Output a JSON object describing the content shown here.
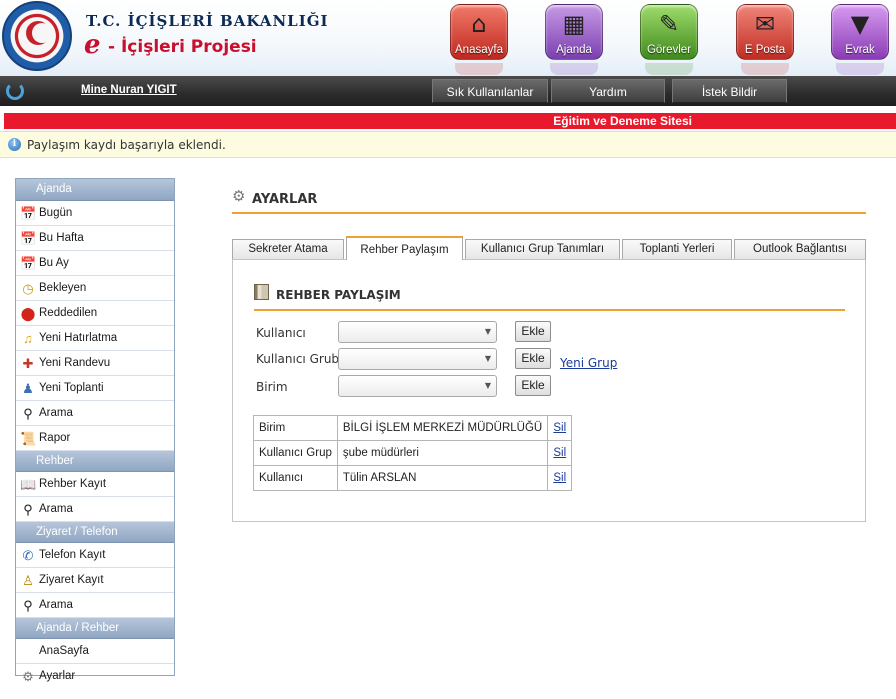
{
  "header": {
    "ministry": "T.C. İÇİŞLERİ BAKANLIĞI",
    "project_prefix": "e",
    "project": "- İçişleri Projesi",
    "seal_text": "TÜRKİYE CUMHURİYETİ İÇİŞLERİ BAKANLIĞI",
    "top_icons": [
      {
        "label": "Anasayfa",
        "icon": "home-icon"
      },
      {
        "label": "Ajanda",
        "icon": "calendar-icon"
      },
      {
        "label": "Görevler",
        "icon": "tasks-icon"
      },
      {
        "label": "E Posta",
        "icon": "mail-icon"
      },
      {
        "label": "Evrak",
        "icon": "document-icon"
      }
    ]
  },
  "navbar": {
    "user": "Mine Nuran YIGIT",
    "buttons": [
      "Sık Kullanılanlar",
      "Yardım",
      "İstek Bildir"
    ]
  },
  "banner": "Eğitim ve Deneme Sitesi",
  "message": "Paylaşım kaydı başarıyla eklendi.",
  "sidebar": {
    "sections": [
      {
        "title": "Ajanda",
        "items": [
          "Bugün",
          "Bu Hafta",
          "Bu Ay",
          "Bekleyen",
          "Reddedilen",
          "Yeni Hatırlatma",
          "Yeni Randevu",
          "Yeni Toplanti",
          "Arama",
          "Rapor"
        ]
      },
      {
        "title": "Rehber",
        "items": [
          "Rehber Kayıt",
          "Arama"
        ]
      },
      {
        "title": "Ziyaret / Telefon",
        "items": [
          "Telefon Kayıt",
          "Ziyaret Kayıt",
          "Arama"
        ]
      },
      {
        "title": "Ajanda / Rehber",
        "items": [
          "AnaSayfa",
          "Ayarlar"
        ]
      }
    ]
  },
  "main": {
    "title": "AYARLAR",
    "tabs": [
      "Sekreter Atama",
      "Rehber Paylaşım",
      "Kullanıcı Grup Tanımları",
      "Toplanti Yerleri",
      "Outlook Bağlantısı"
    ],
    "active_tab": "Rehber Paylaşım",
    "section_title": "REHBER PAYLAŞIM",
    "form": {
      "fields": [
        {
          "label": "Kullanıcı",
          "value": ""
        },
        {
          "label": "Kullanıcı Grubu",
          "value": ""
        },
        {
          "label": "Birim",
          "value": ""
        }
      ],
      "add_label": "Ekle",
      "new_group": "Yeni Grup"
    },
    "shares": [
      {
        "type": "Birim",
        "name": "BİLGİ İŞLEM MERKEZİ MÜDÜRLÜĞÜ",
        "action": "Sil"
      },
      {
        "type": "Kullanıcı Grup",
        "name": "şube müdürleri",
        "action": "Sil"
      },
      {
        "type": "Kullanıcı",
        "name": "Tülin ARSLAN",
        "action": "Sil"
      }
    ]
  },
  "colors": {
    "accent": "#f0a030",
    "banner": "#e8192c",
    "link": "#1a3d9a",
    "sidebar_head": "#8fa6c2"
  }
}
